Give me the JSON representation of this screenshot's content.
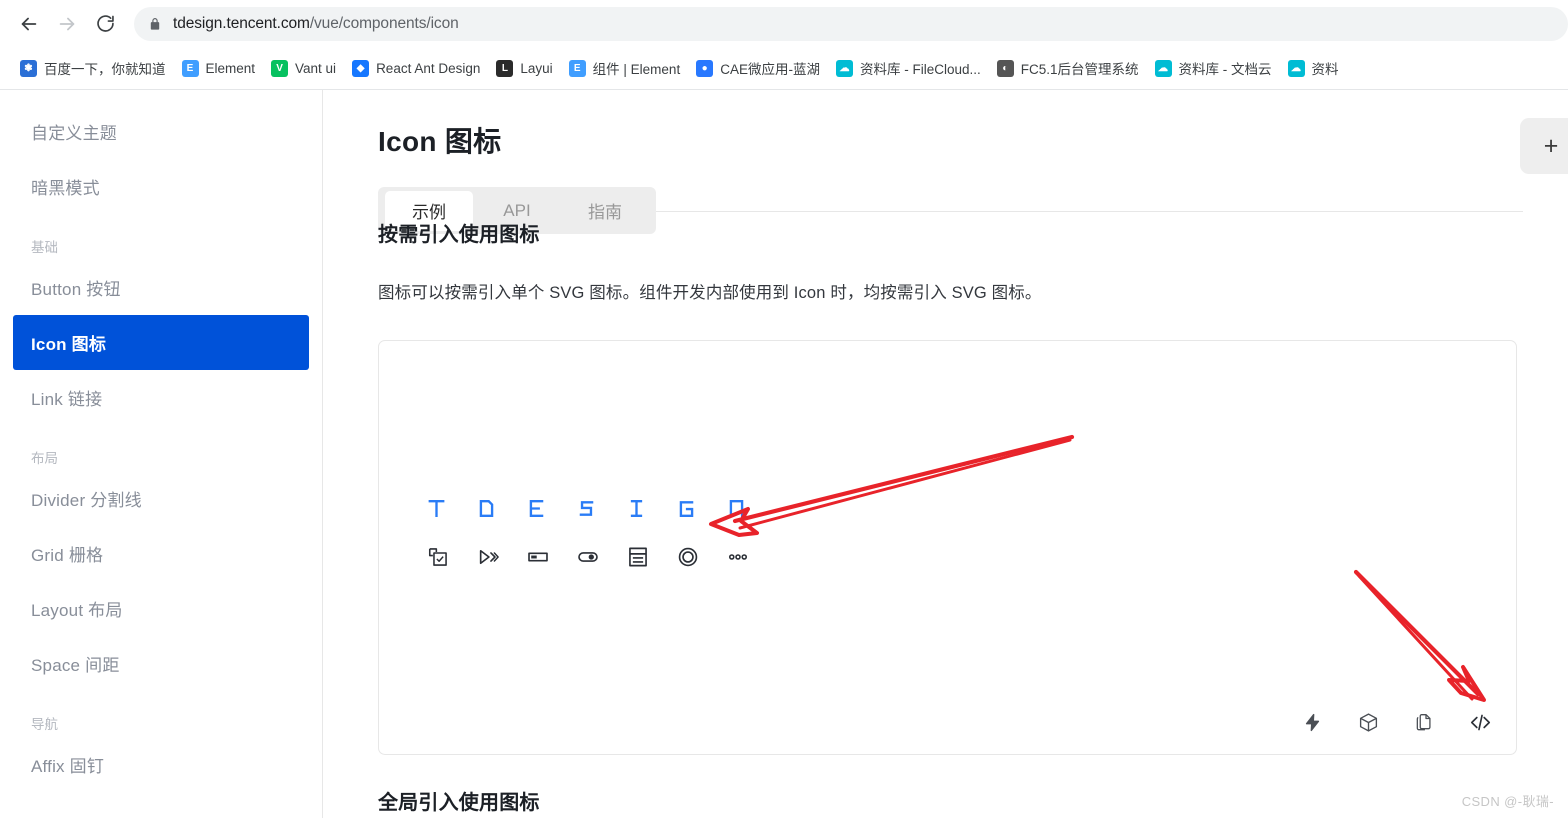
{
  "browser": {
    "back_label": "Back",
    "forward_label": "Forward",
    "reload_label": "Reload",
    "lock_label": "View site information",
    "url_secure": "tdesign.tencent.com",
    "url_path": "/vue/components/icon",
    "url_full": "tdesign.tencent.com/vue/components/icon",
    "bookmarks": [
      {
        "label": "百度一下，你就知道",
        "icon": "baidu-paw-icon",
        "color": "#2b6fd6",
        "glyph": "❃"
      },
      {
        "label": "Element",
        "icon": "element-icon",
        "color": "#409eff",
        "glyph": "E"
      },
      {
        "label": "Vant ui",
        "icon": "vant-icon",
        "color": "#07c160",
        "glyph": "V"
      },
      {
        "label": "React Ant Design",
        "icon": "ant-design-icon",
        "color": "#1677ff",
        "glyph": "◆"
      },
      {
        "label": "Layui",
        "icon": "layui-icon",
        "color": "#2b2b2b",
        "glyph": "L"
      },
      {
        "label": "组件 | Element",
        "icon": "element-icon",
        "color": "#409eff",
        "glyph": "E"
      },
      {
        "label": "CAE微应用-蓝湖",
        "icon": "lanhu-icon",
        "color": "#2878ff",
        "glyph": "●"
      },
      {
        "label": "资料库 - FileCloud...",
        "icon": "filecloud-icon",
        "color": "#00bcd4",
        "glyph": "☁"
      },
      {
        "label": "FC5.1后台管理系统",
        "icon": "globe-icon",
        "color": "#555555",
        "glyph": "◐"
      },
      {
        "label": "资料库 - 文档云",
        "icon": "filecloud-icon",
        "color": "#00bcd4",
        "glyph": "☁"
      },
      {
        "label": "资料",
        "icon": "filecloud-icon",
        "color": "#00bcd4",
        "glyph": "☁"
      }
    ]
  },
  "sidebar": {
    "items": [
      {
        "type": "link",
        "label": "自定义主题",
        "active": false,
        "name": "sidebar-item-custom-theme"
      },
      {
        "type": "link",
        "label": "暗黑模式",
        "active": false,
        "name": "sidebar-item-dark-mode"
      },
      {
        "type": "group",
        "label": "基础",
        "active": false,
        "name": "sidebar-group-basic"
      },
      {
        "type": "link",
        "label": "Button 按钮",
        "active": false,
        "name": "sidebar-item-button"
      },
      {
        "type": "link",
        "label": "Icon 图标",
        "active": true,
        "name": "sidebar-item-icon"
      },
      {
        "type": "link",
        "label": "Link 链接",
        "active": false,
        "name": "sidebar-item-link"
      },
      {
        "type": "group",
        "label": "布局",
        "active": false,
        "name": "sidebar-group-layout"
      },
      {
        "type": "link",
        "label": "Divider 分割线",
        "active": false,
        "name": "sidebar-item-divider"
      },
      {
        "type": "link",
        "label": "Grid 栅格",
        "active": false,
        "name": "sidebar-item-grid"
      },
      {
        "type": "link",
        "label": "Layout 布局",
        "active": false,
        "name": "sidebar-item-layout"
      },
      {
        "type": "link",
        "label": "Space 间距",
        "active": false,
        "name": "sidebar-item-space"
      },
      {
        "type": "group",
        "label": "导航",
        "active": false,
        "name": "sidebar-group-nav"
      },
      {
        "type": "link",
        "label": "Affix 固钉",
        "active": false,
        "name": "sidebar-item-affix"
      }
    ]
  },
  "main": {
    "title": "Icon 图标",
    "tabs": [
      {
        "label": "示例",
        "active": true,
        "name": "tab-example"
      },
      {
        "label": "API",
        "active": false,
        "name": "tab-api"
      },
      {
        "label": "指南",
        "active": false,
        "name": "tab-guide"
      }
    ],
    "section_heading": "按需引入使用图标",
    "section_desc": "图标可以按需引入单个 SVG 图标。组件开发内部使用到 Icon 时，均按需引入 SVG 图标。",
    "next_heading": "全局引入使用图标",
    "demo": {
      "logo_letters": [
        "T",
        "D",
        "E",
        "S",
        "I",
        "G",
        "N"
      ],
      "logo_color": "#2a7cf6",
      "icons": [
        {
          "name": "check-rectangle-icon",
          "label": "复制勾选"
        },
        {
          "name": "play-forward-icon",
          "label": "快进播放"
        },
        {
          "name": "input-field-icon",
          "label": "输入框"
        },
        {
          "name": "switch-toggle-icon",
          "label": "开关"
        },
        {
          "name": "list-layout-icon",
          "label": "列表布局"
        },
        {
          "name": "radio-circle-icon",
          "label": "单选圆环"
        },
        {
          "name": "ellipsis-icon",
          "label": "更多"
        }
      ],
      "actions": [
        {
          "name": "lightning-icon",
          "label": "在 StackBlitz 中打开"
        },
        {
          "name": "cube-icon",
          "label": "在 CodeSandbox 中打开"
        },
        {
          "name": "copy-file-icon",
          "label": "复制代码"
        },
        {
          "name": "code-brackets-icon",
          "label": "显示代码"
        }
      ]
    }
  },
  "right_panel": {
    "plus_label": "+",
    "name": "add-panel-button"
  },
  "annotations": {
    "arrow_1": "指向示例图标区域的红色箭头",
    "arrow_2": "指向显示代码按钮的红色箭头",
    "accent_red": "#e8232a"
  },
  "watermark": "CSDN @-耿瑞-"
}
